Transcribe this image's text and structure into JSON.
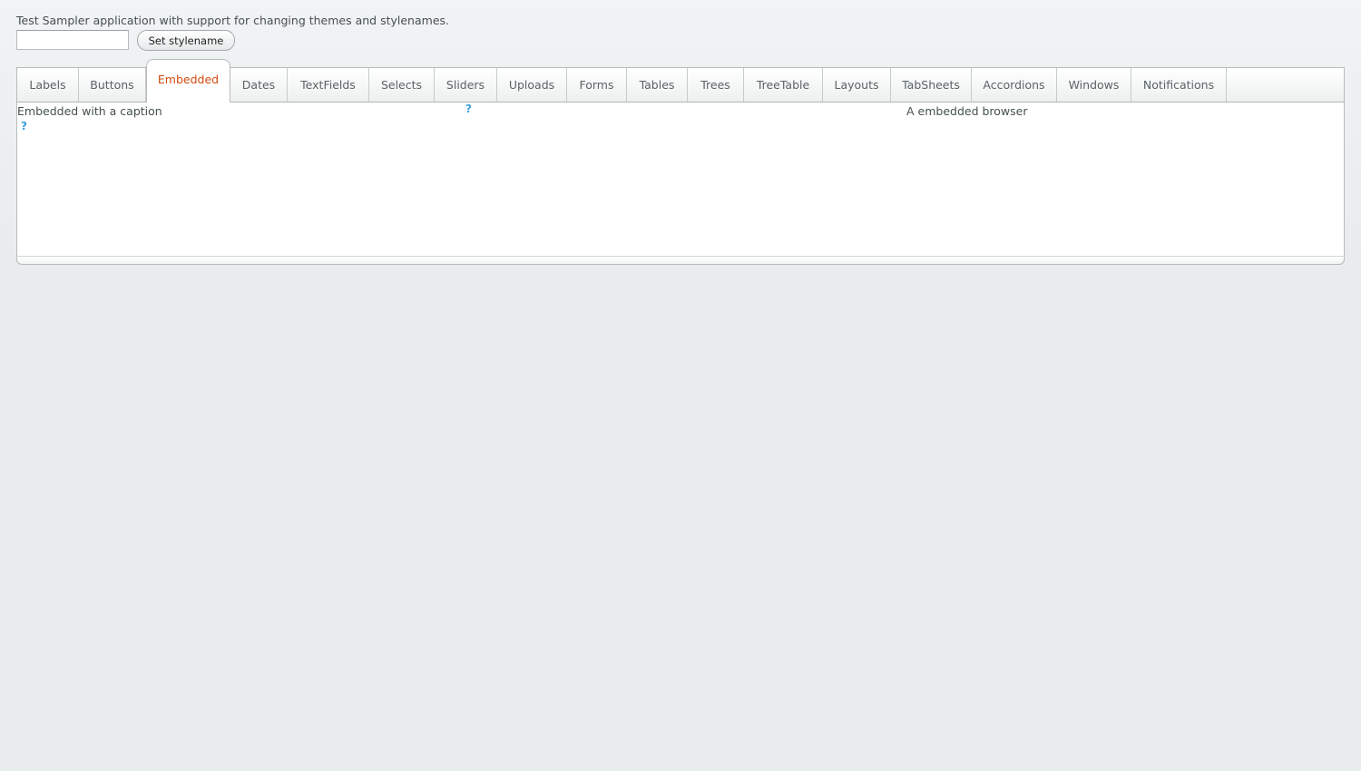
{
  "intro": {
    "text": "Test Sampler application with support for changing themes and stylenames."
  },
  "stylename": {
    "input_value": "",
    "button_label": "Set stylename"
  },
  "tabs": [
    {
      "label": "Labels",
      "selected": false
    },
    {
      "label": "Buttons",
      "selected": false
    },
    {
      "label": "Embedded",
      "selected": true
    },
    {
      "label": "Dates",
      "selected": false
    },
    {
      "label": "TextFields",
      "selected": false
    },
    {
      "label": "Selects",
      "selected": false
    },
    {
      "label": "Sliders",
      "selected": false
    },
    {
      "label": "Uploads",
      "selected": false
    },
    {
      "label": "Forms",
      "selected": false
    },
    {
      "label": "Tables",
      "selected": false
    },
    {
      "label": "Trees",
      "selected": false
    },
    {
      "label": "TreeTable",
      "selected": false
    },
    {
      "label": "Layouts",
      "selected": false
    },
    {
      "label": "TabSheets",
      "selected": false
    },
    {
      "label": "Accordions",
      "selected": false
    },
    {
      "label": "Windows",
      "selected": false
    },
    {
      "label": "Notifications",
      "selected": false
    }
  ],
  "embedded": {
    "caption_left": "Embedded with a caption",
    "caption_right": "A embedded browser",
    "missing_icon_glyph": "?",
    "icon_name": "missing-image-icon"
  },
  "colors": {
    "selected_tab_text": "#d44a0e",
    "missing_icon": "#3b9fe0"
  }
}
